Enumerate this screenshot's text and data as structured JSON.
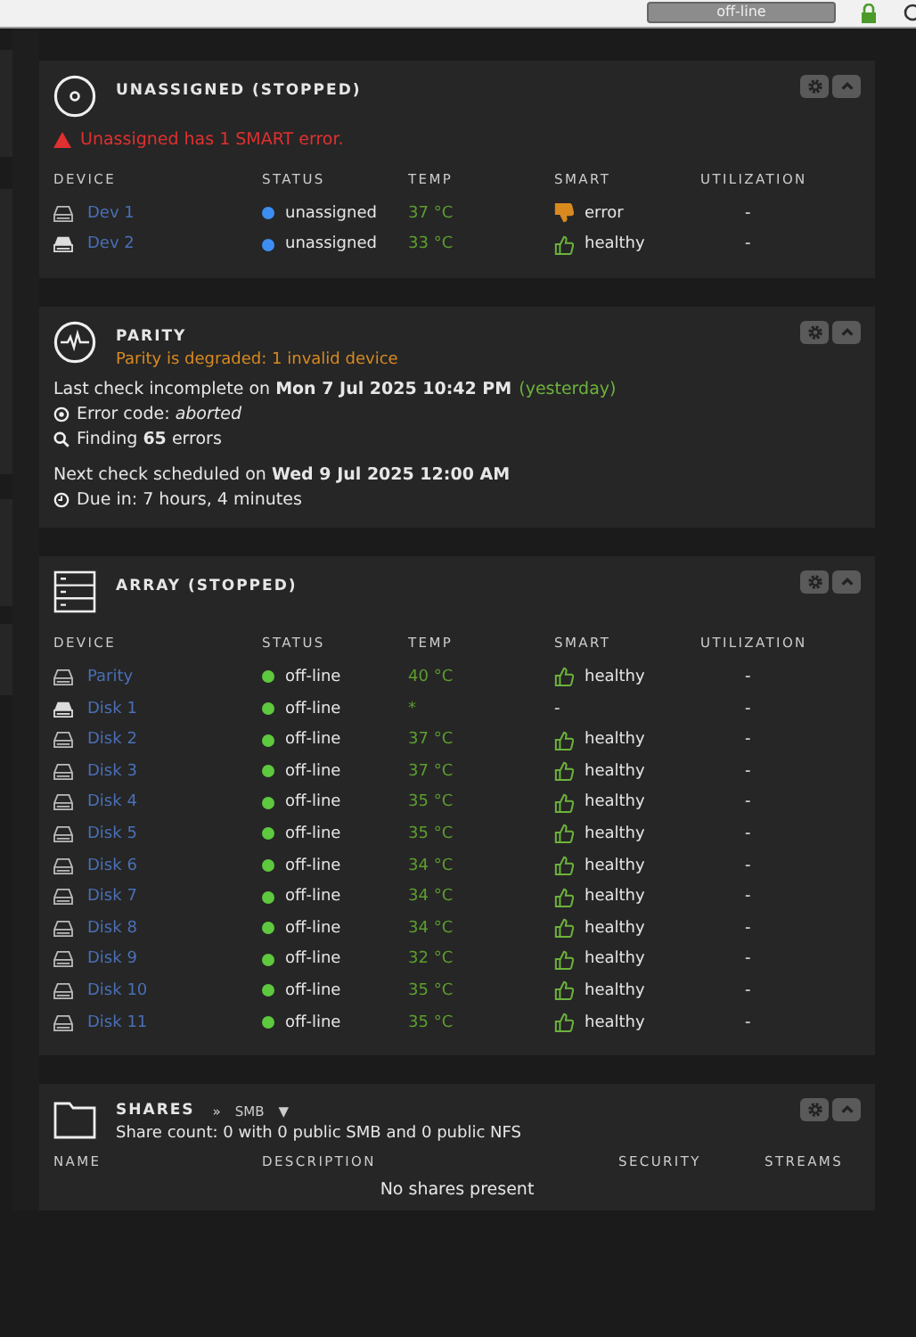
{
  "top_bar": {
    "status_button": "off-line"
  },
  "unassigned": {
    "title": "UNASSIGNED (STOPPED)",
    "warning": "Unassigned has 1 SMART error.",
    "columns": [
      "DEVICE",
      "STATUS",
      "TEMP",
      "SMART",
      "UTILIZATION"
    ],
    "rows": [
      {
        "device": "Dev 1",
        "kind": "outline",
        "status": "unassigned",
        "color": "#3d8ef2",
        "temp": "37 °C",
        "smart": "error",
        "smart_checked": true,
        "smart_error": true,
        "utilization": "-"
      },
      {
        "device": "Dev 2",
        "kind": "solid",
        "status": "unassigned",
        "color": "#3d8ef2",
        "temp": "33 °C",
        "smart": "healthy",
        "smart_checked": true,
        "smart_error": false,
        "utilization": "-"
      }
    ]
  },
  "parity": {
    "title": "PARITY",
    "subtitle": "Parity is degraded: 1 invalid device",
    "last_check": "Last check incomplete on **Mon 7 Jul 2025 10:42 PM**",
    "last_check_relative": "(yesterday)",
    "error_code": "Error code: *aborted*",
    "finding": "Finding **65** errors",
    "next_check": "Next check scheduled on **Wed 9 Jul 2025 12:00 AM**",
    "due_in": "Due in: 7 hours, 4 minutes"
  },
  "array": {
    "title": "ARRAY (STOPPED)",
    "columns": [
      "DEVICE",
      "STATUS",
      "TEMP",
      "SMART",
      "UTILIZATION"
    ],
    "rows": [
      {
        "device": "Parity",
        "kind": "outline",
        "status": "off-line",
        "color": "#5ec83f",
        "temp": "40 °C",
        "smart": "healthy",
        "smart_checked": true,
        "smart_error": false,
        "utilization": "-"
      },
      {
        "device": "Disk 1",
        "kind": "solid",
        "status": "off-line",
        "color": "#5ec83f",
        "temp": "*",
        "smart": "-",
        "smart_checked": false,
        "utilization": "-"
      },
      {
        "device": "Disk 2",
        "kind": "outline",
        "status": "off-line",
        "color": "#5ec83f",
        "temp": "37 °C",
        "smart": "healthy",
        "smart_checked": true,
        "smart_error": false,
        "utilization": "-"
      },
      {
        "device": "Disk 3",
        "kind": "outline",
        "status": "off-line",
        "color": "#5ec83f",
        "temp": "37 °C",
        "smart": "healthy",
        "smart_checked": true,
        "smart_error": false,
        "utilization": "-"
      },
      {
        "device": "Disk 4",
        "kind": "outline",
        "status": "off-line",
        "color": "#5ec83f",
        "temp": "35 °C",
        "smart": "healthy",
        "smart_checked": true,
        "smart_error": false,
        "utilization": "-"
      },
      {
        "device": "Disk 5",
        "kind": "outline",
        "status": "off-line",
        "color": "#5ec83f",
        "temp": "35 °C",
        "smart": "healthy",
        "smart_checked": true,
        "smart_error": false,
        "utilization": "-"
      },
      {
        "device": "Disk 6",
        "kind": "outline",
        "status": "off-line",
        "color": "#5ec83f",
        "temp": "34 °C",
        "smart": "healthy",
        "smart_checked": true,
        "smart_error": false,
        "utilization": "-"
      },
      {
        "device": "Disk 7",
        "kind": "outline",
        "status": "off-line",
        "color": "#5ec83f",
        "temp": "34 °C",
        "smart": "healthy",
        "smart_checked": true,
        "smart_error": false,
        "utilization": "-"
      },
      {
        "device": "Disk 8",
        "kind": "outline",
        "status": "off-line",
        "color": "#5ec83f",
        "temp": "34 °C",
        "smart": "healthy",
        "smart_checked": true,
        "smart_error": false,
        "utilization": "-"
      },
      {
        "device": "Disk 9",
        "kind": "outline",
        "status": "off-line",
        "color": "#5ec83f",
        "temp": "32 °C",
        "smart": "healthy",
        "smart_checked": true,
        "smart_error": false,
        "utilization": "-"
      },
      {
        "device": "Disk 10",
        "kind": "outline",
        "status": "off-line",
        "color": "#5ec83f",
        "temp": "35 °C",
        "smart": "healthy",
        "smart_checked": true,
        "smart_error": false,
        "utilization": "-"
      },
      {
        "device": "Disk 11",
        "kind": "outline",
        "status": "off-line",
        "color": "#5ec83f",
        "temp": "35 °C",
        "smart": "healthy",
        "smart_checked": true,
        "smart_error": false,
        "utilization": "-"
      }
    ]
  },
  "shares": {
    "title": "SHARES",
    "breadcrumb_mark": "»",
    "protocol": "SMB",
    "dropdown_mark": "▼",
    "summary": "Share count: 0 with 0 public SMB and 0 public NFS",
    "columns": [
      "NAME",
      "DESCRIPTION",
      "SECURITY",
      "STREAMS"
    ],
    "empty_message": "No shares present"
  }
}
